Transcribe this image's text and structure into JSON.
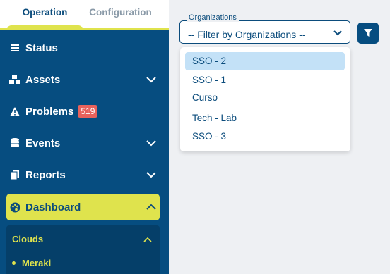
{
  "tabs": {
    "operation": "Operation",
    "configuration": "Configuration"
  },
  "nav": {
    "status": "Status",
    "assets": "Assets",
    "problems": "Problems",
    "problems_count": "519",
    "events": "Events",
    "reports": "Reports",
    "dashboard": "Dashboard"
  },
  "submenu": {
    "title": "Clouds",
    "item": "Meraki"
  },
  "filter": {
    "legend": "Organizations",
    "value": "-- Filter by Organizations --",
    "options": [
      "SSO - 2",
      "SSO - 1",
      "Curso",
      "Tech - Lab",
      "SSO - 3"
    ]
  },
  "colors": {
    "sidebar": "#064d80",
    "accent": "#dfe34d",
    "badge": "#e8625c",
    "selected_option": "#c3e1f7"
  }
}
